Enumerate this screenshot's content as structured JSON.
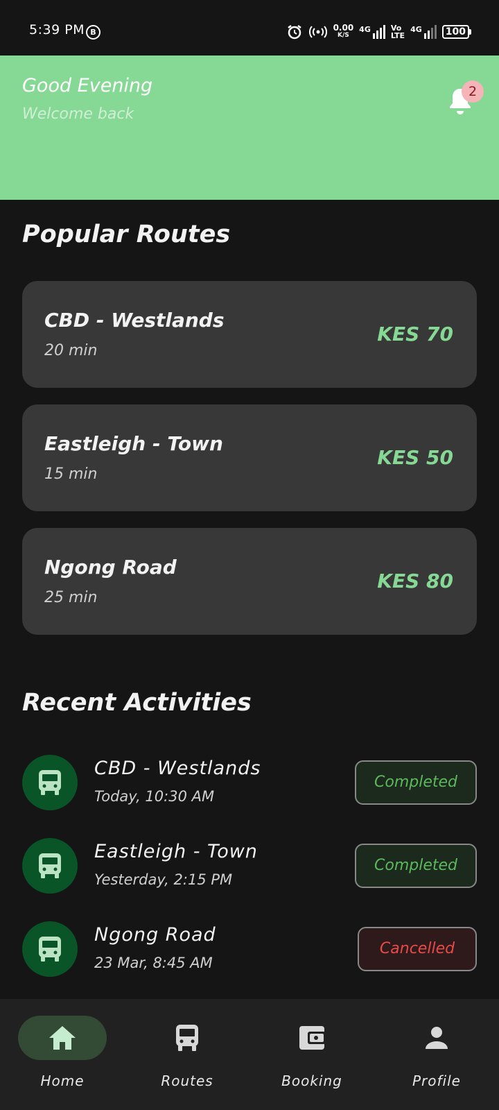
{
  "status_bar": {
    "time": "5:39 PM",
    "b_icon": "B",
    "net_speed_value": "0.00",
    "net_speed_unit": "K/S",
    "sig1_label": "4G",
    "volte_top": "Vo",
    "volte_bottom": "LTE",
    "sig2_label": "4G",
    "battery": "100"
  },
  "header": {
    "greeting": "Good Evening",
    "subtitle": "Welcome back",
    "notification_count": "2",
    "bg_color": "#86d994"
  },
  "popular_routes": {
    "title": "Popular Routes",
    "items": [
      {
        "name": "CBD - Westlands",
        "duration": "20 min",
        "price": "KES 70"
      },
      {
        "name": "Eastleigh - Town",
        "duration": "15 min",
        "price": "KES 50"
      },
      {
        "name": "Ngong Road",
        "duration": "25 min",
        "price": "KES 80"
      }
    ]
  },
  "recent_activities": {
    "title": "Recent Activities",
    "items": [
      {
        "name": "CBD - Westlands",
        "time": "Today, 10:30 AM",
        "status": "Completed",
        "icon": "bus-icon"
      },
      {
        "name": "Eastleigh - Town",
        "time": "Yesterday, 2:15 PM",
        "status": "Completed",
        "icon": "bus-icon"
      },
      {
        "name": "Ngong Road",
        "time": "23 Mar, 8:45 AM",
        "status": "Cancelled",
        "icon": "bus-icon"
      }
    ]
  },
  "bottom_nav": {
    "items": [
      {
        "label": "Home",
        "icon": "home-icon",
        "active": true
      },
      {
        "label": "Routes",
        "icon": "bus-icon",
        "active": false
      },
      {
        "label": "Booking",
        "icon": "wallet-icon",
        "active": false
      },
      {
        "label": "Profile",
        "icon": "person-icon",
        "active": false
      }
    ]
  },
  "colors": {
    "accent": "#86d994",
    "completed": "#5cb85c",
    "cancelled": "#e84a4a",
    "card": "#383838"
  }
}
